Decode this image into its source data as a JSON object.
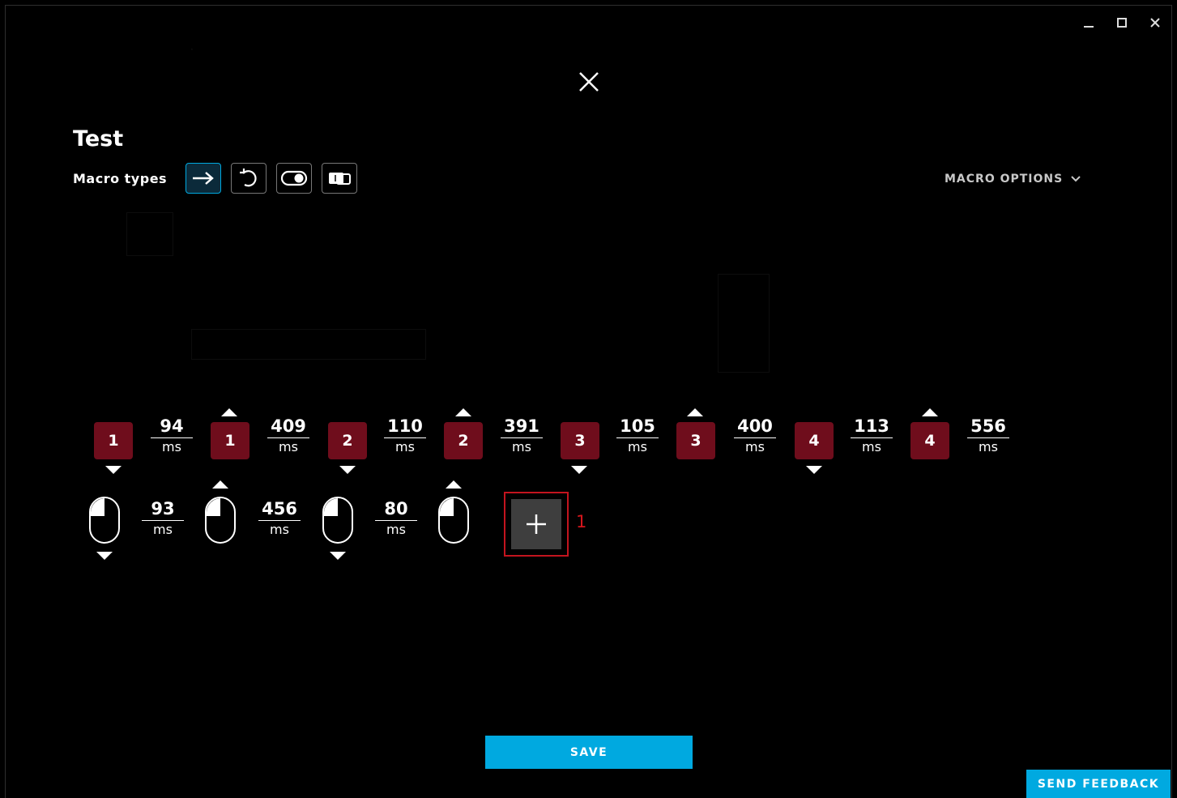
{
  "title": "Test",
  "macro_types_label": "Macro types",
  "macro_type_buttons": [
    {
      "icon": "arrow-right-icon",
      "active": true
    },
    {
      "icon": "repeat-icon",
      "active": false
    },
    {
      "icon": "toggle-icon",
      "active": false
    },
    {
      "icon": "sequence-icon",
      "active": false
    }
  ],
  "macro_options_label": "MACRO OPTIONS",
  "row1": {
    "keys": [
      {
        "label": "1",
        "direction": "down"
      },
      {
        "label": "1",
        "direction": "up"
      },
      {
        "label": "2",
        "direction": "down"
      },
      {
        "label": "2",
        "direction": "up"
      },
      {
        "label": "3",
        "direction": "down"
      },
      {
        "label": "3",
        "direction": "up"
      },
      {
        "label": "4",
        "direction": "down"
      },
      {
        "label": "4",
        "direction": "up"
      }
    ],
    "delays": [
      "94",
      "409",
      "110",
      "391",
      "105",
      "400",
      "113",
      "556"
    ]
  },
  "row2": {
    "mouse_events": [
      {
        "button": "left",
        "direction": "down"
      },
      {
        "button": "left",
        "direction": "up"
      },
      {
        "button": "left",
        "direction": "down"
      },
      {
        "button": "left",
        "direction": "up"
      }
    ],
    "delays": [
      "93",
      "456",
      "80"
    ]
  },
  "delay_unit": "ms",
  "add_annotation": "1",
  "save_label": "SAVE",
  "feedback_label": "SEND FEEDBACK",
  "colors": {
    "accent": "#00a9e0",
    "key_bg": "#6f0d1c",
    "highlight": "#c3141e",
    "background": "#000000"
  }
}
